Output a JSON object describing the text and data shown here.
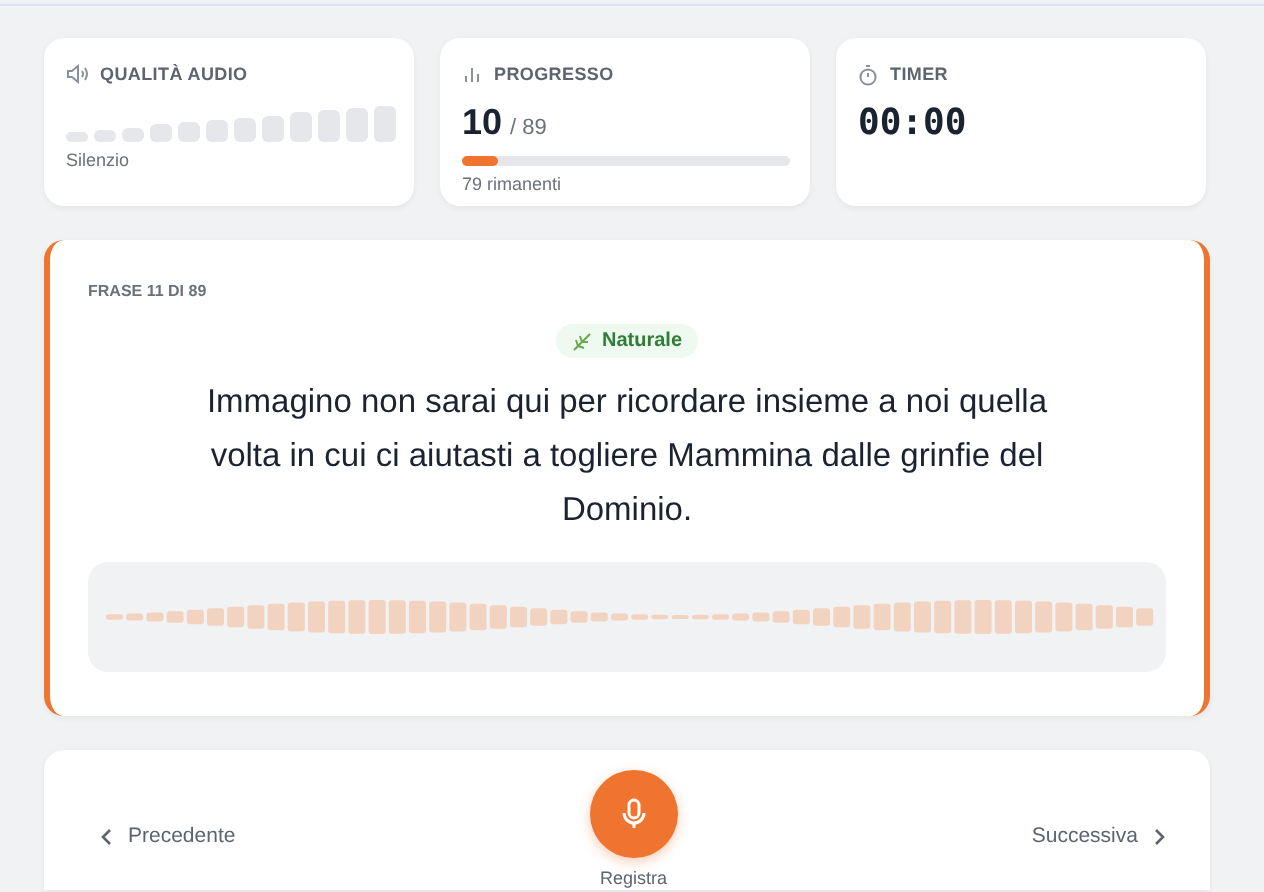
{
  "stats": [
    {
      "kind": "audio",
      "title": "QUALITÀ AUDIO",
      "level": 0,
      "caption": "Silenzio"
    },
    {
      "kind": "progress",
      "title": "PROGRESSO",
      "value": "10",
      "total": "/ 89",
      "level": 0.11,
      "caption": "79 rimanenti"
    },
    {
      "kind": "timer",
      "title": "TIMER",
      "value": "00:00"
    }
  ],
  "phrase": {
    "counter": "FRASE 11 DI 89",
    "tag": "Naturale",
    "text": "Immagino non sarai qui per ricordare insieme a noi quella volta in cui ci aiutasti a togliere Mammina dalle grinfie del Dominio."
  },
  "navigation": {
    "previous": "Precedente",
    "next": "Successiva",
    "record": "Registra"
  }
}
